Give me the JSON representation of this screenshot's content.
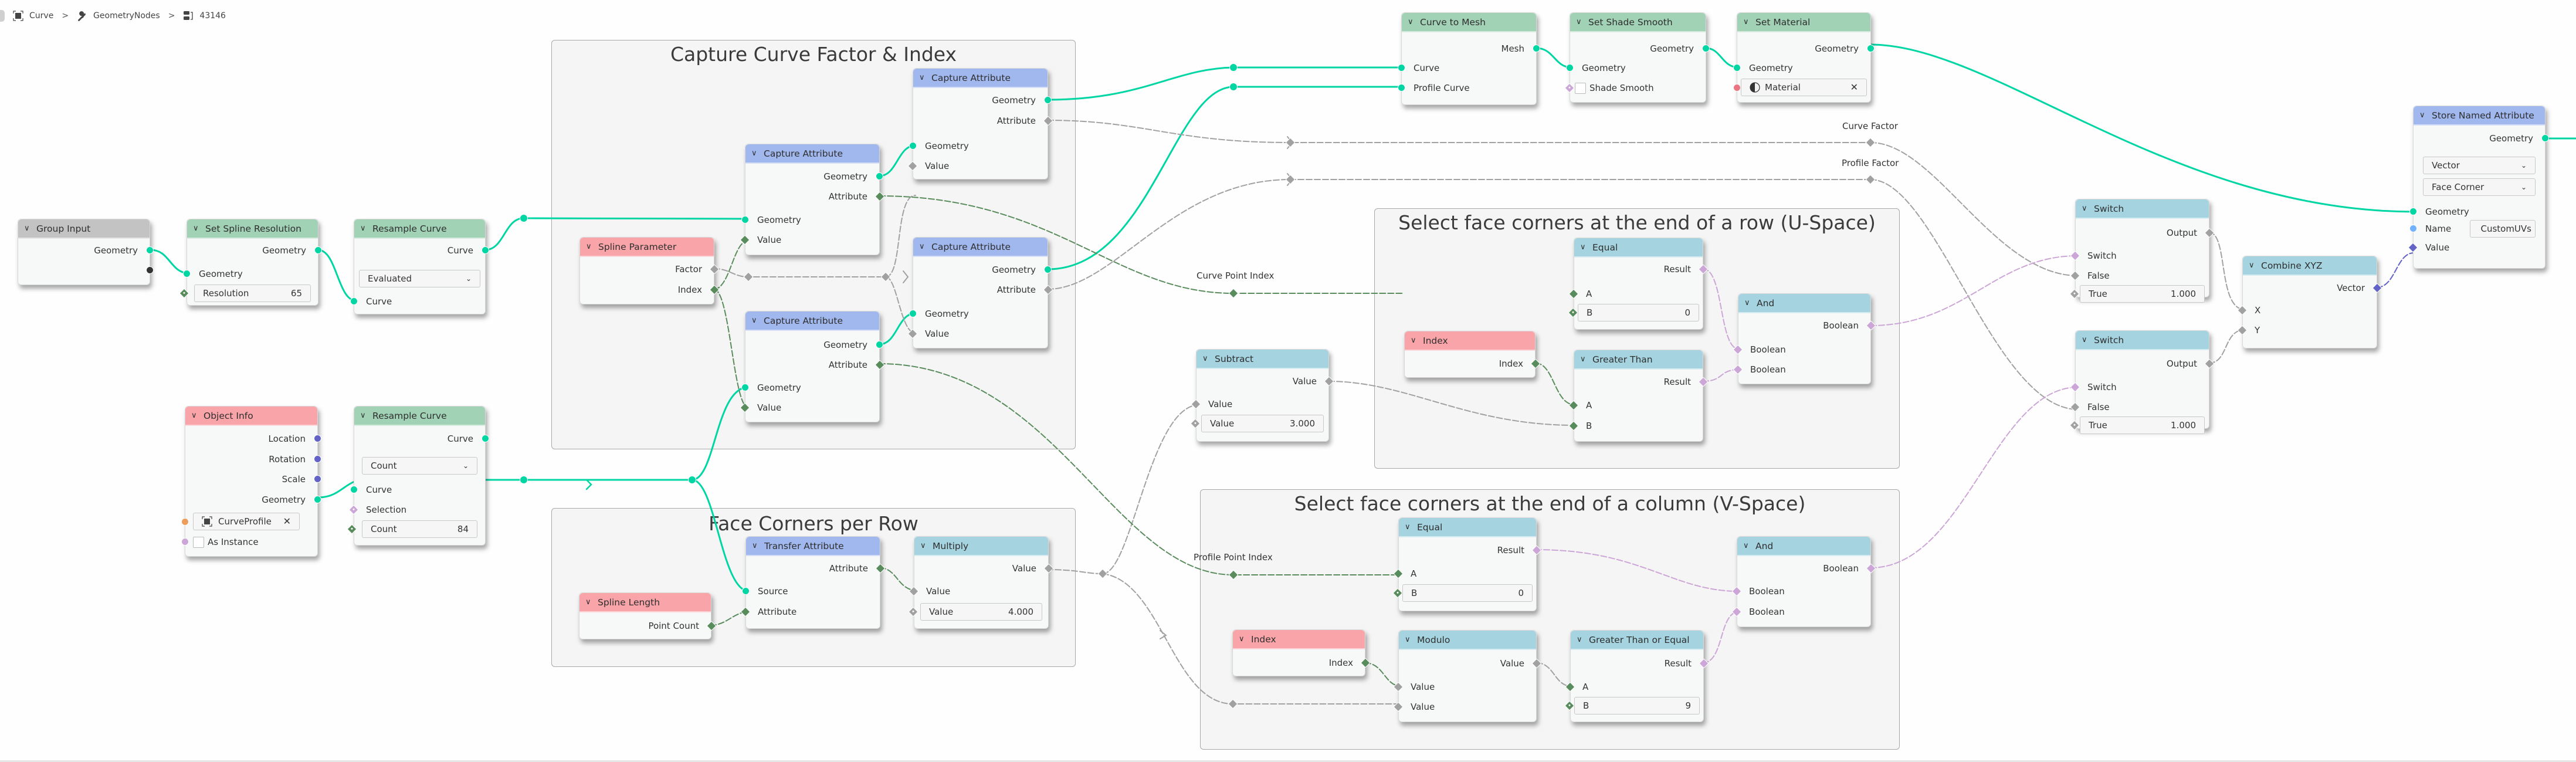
{
  "breadcrumb": {
    "items": [
      {
        "icon": "object-icon",
        "label": "Curve"
      },
      {
        "icon": "wrench-icon",
        "label": "GeometryNodes"
      },
      {
        "icon": "node-tree-icon",
        "label": "43146"
      }
    ],
    "separator": ">"
  },
  "colors": {
    "geometry_socket": "#00d6a3",
    "float_socket": "#a1a1a1",
    "integer_socket": "#598c5c",
    "boolean_socket": "#cca6d6",
    "vector_socket": "#6363c7",
    "string_socket": "#70b2ff",
    "object_socket": "#ed9e5c",
    "material_socket": "#eb7582",
    "geometry_node_header": "#a1d2b5",
    "attribute_node_header": "#a1b8ee",
    "input_node_header": "#f8a4a8",
    "converter_node_header": "#a5d4e0",
    "group_node_header": "#c3c3c3"
  },
  "frames": {
    "capture": "Capture Curve Factor & Index",
    "face_corners": "Face Corners per Row",
    "u_space": "Select face corners at the end of a row (U-Space)",
    "v_space": "Select face corners at the end of a column (V-Space)"
  },
  "link_labels": {
    "curve_factor": "Curve Factor",
    "profile_factor": "Profile Factor",
    "curve_point_index": "Curve Point Index",
    "profile_point_index": "Profile Point Index"
  },
  "nodes": {
    "group_input": {
      "title": "Group Input",
      "outputs": [
        "Geometry"
      ]
    },
    "set_spline_resolution": {
      "title": "Set Spline Resolution",
      "outputs": [
        "Geometry"
      ],
      "inputs": [
        "Geometry"
      ],
      "field": {
        "label": "Resolution",
        "value": "65"
      }
    },
    "resample_curve_1": {
      "title": "Resample Curve",
      "outputs": [
        "Curve"
      ],
      "mode": "Evaluated",
      "inputs": [
        "Curve"
      ]
    },
    "object_info": {
      "title": "Object Info",
      "outputs": [
        "Location",
        "Rotation",
        "Scale",
        "Geometry"
      ],
      "object": "CurveProfile",
      "as_instance": "As Instance"
    },
    "resample_curve_2": {
      "title": "Resample Curve",
      "outputs": [
        "Curve"
      ],
      "mode": "Count",
      "inputs": [
        "Curve",
        "Selection"
      ],
      "field": {
        "label": "Count",
        "value": "84"
      }
    },
    "spline_parameter": {
      "title": "Spline Parameter",
      "outputs": [
        "Factor",
        "Index"
      ]
    },
    "capture_1": {
      "title": "Capture Attribute",
      "outputs": [
        "Geometry",
        "Attribute"
      ],
      "inputs": [
        "Geometry",
        "Value"
      ]
    },
    "capture_2": {
      "title": "Capture Attribute",
      "outputs": [
        "Geometry",
        "Attribute"
      ],
      "inputs": [
        "Geometry",
        "Value"
      ]
    },
    "capture_3": {
      "title": "Capture Attribute",
      "outputs": [
        "Geometry",
        "Attribute"
      ],
      "inputs": [
        "Geometry",
        "Value"
      ]
    },
    "capture_4": {
      "title": "Capture Attribute",
      "outputs": [
        "Geometry",
        "Attribute"
      ],
      "inputs": [
        "Geometry",
        "Value"
      ]
    },
    "spline_length": {
      "title": "Spline Length",
      "outputs": [
        "Point Count"
      ]
    },
    "transfer_attribute": {
      "title": "Transfer Attribute",
      "outputs": [
        "Attribute"
      ],
      "inputs": [
        "Source",
        "Attribute"
      ]
    },
    "multiply": {
      "title": "Multiply",
      "outputs": [
        "Value"
      ],
      "inputs": [
        "Value"
      ],
      "field": {
        "label": "Value",
        "value": "4.000"
      }
    },
    "curve_to_mesh": {
      "title": "Curve to Mesh",
      "outputs": [
        "Mesh"
      ],
      "inputs": [
        "Curve",
        "Profile Curve"
      ]
    },
    "set_shade_smooth": {
      "title": "Set Shade Smooth",
      "outputs": [
        "Geometry"
      ],
      "inputs": [
        "Geometry"
      ],
      "checkbox": "Shade Smooth"
    },
    "set_material": {
      "title": "Set Material",
      "outputs": [
        "Geometry"
      ],
      "inputs": [
        "Geometry"
      ],
      "material": "Material"
    },
    "subtract": {
      "title": "Subtract",
      "outputs": [
        "Value"
      ],
      "inputs": [
        "Value"
      ],
      "field": {
        "label": "Value",
        "value": "3.000"
      }
    },
    "equal_u": {
      "title": "Equal",
      "outputs": [
        "Result"
      ],
      "inputs": [
        "A"
      ],
      "field": {
        "label": "B",
        "value": "0"
      }
    },
    "index_u": {
      "title": "Index",
      "outputs": [
        "Index"
      ]
    },
    "greater_than": {
      "title": "Greater Than",
      "outputs": [
        "Result"
      ],
      "inputs": [
        "A",
        "B"
      ]
    },
    "and_u": {
      "title": "And",
      "outputs": [
        "Boolean"
      ],
      "inputs": [
        "Boolean",
        "Boolean"
      ]
    },
    "equal_v": {
      "title": "Equal",
      "outputs": [
        "Result"
      ],
      "inputs": [
        "A"
      ],
      "field": {
        "label": "B",
        "value": "0"
      }
    },
    "index_v": {
      "title": "Index",
      "outputs": [
        "Index"
      ]
    },
    "modulo": {
      "title": "Modulo",
      "outputs": [
        "Value"
      ],
      "inputs": [
        "Value",
        "Value"
      ]
    },
    "greater_equal": {
      "title": "Greater Than or Equal",
      "outputs": [
        "Result"
      ],
      "inputs": [
        "A"
      ],
      "field": {
        "label": "B",
        "value": "9"
      }
    },
    "and_v": {
      "title": "And",
      "outputs": [
        "Boolean"
      ],
      "inputs": [
        "Boolean",
        "Boolean"
      ]
    },
    "switch_1": {
      "title": "Switch",
      "outputs": [
        "Output"
      ],
      "inputs": [
        "Switch",
        "False"
      ],
      "field": {
        "label": "True",
        "value": "1.000"
      }
    },
    "switch_2": {
      "title": "Switch",
      "outputs": [
        "Output"
      ],
      "inputs": [
        "Switch",
        "False"
      ],
      "field": {
        "label": "True",
        "value": "1.000"
      }
    },
    "combine_xyz": {
      "title": "Combine XYZ",
      "outputs": [
        "Vector"
      ],
      "inputs": [
        "X",
        "Y"
      ]
    },
    "store_named_attribute": {
      "title": "Store Named Attribute",
      "outputs": [
        "Geometry"
      ],
      "data_type": "Vector",
      "domain": "Face Corner",
      "inputs": [
        "Geometry",
        "Name",
        "Value"
      ],
      "name_value": "CustomUVs"
    }
  }
}
